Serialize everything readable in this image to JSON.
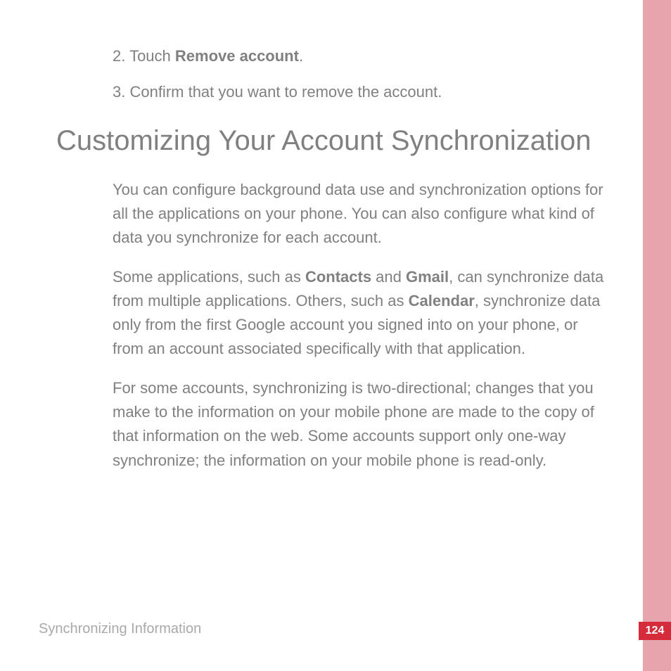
{
  "steps": {
    "s2_prefix": "2. Touch ",
    "s2_bold": "Remove account",
    "s2_suffix": ".",
    "s3": "3. Confirm that you want to remove the account."
  },
  "heading": "Customizing Your Account Synchronization",
  "para1": "You can configure background data use and synchronization options for all the applications on your phone. You can also configure what kind of data you synchronize for each account.",
  "para2": {
    "t1": "Some applications, such as ",
    "b1": "Contacts",
    "t2": " and ",
    "b2": "Gmail",
    "t3": ", can synchronize data from multiple applications. Others, such as ",
    "b3": "Calendar",
    "t4": ", synchronize data only from the first Google account you signed into on your phone, or from an account associated specifically with that application."
  },
  "para3": "For some accounts, synchronizing is two-directional; changes that you make to the information on your mobile phone are made to the copy of that information on the web. Some accounts support only one-way synchronize; the information on your mobile phone is read-only.",
  "footer": "Synchronizing Information",
  "page_number": "124"
}
